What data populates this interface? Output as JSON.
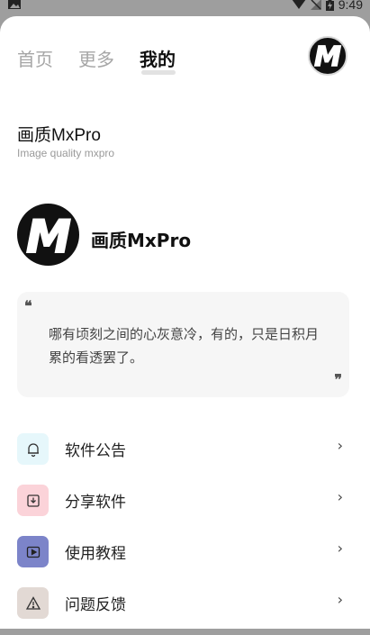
{
  "status_bar": {
    "time": "9:49"
  },
  "tabs": [
    {
      "label": "首页",
      "active": false
    },
    {
      "label": "更多",
      "active": false
    },
    {
      "label": "我的",
      "active": true
    }
  ],
  "app": {
    "title": "画质MxPro",
    "subtitle": "Image quality mxpro"
  },
  "profile": {
    "name": "画质MxPro",
    "logo_text": "M"
  },
  "quote": {
    "open_mark": "❝",
    "text": "哪有顷刻之间的心灰意冷，有的，只是日积月累的看透罢了。",
    "close_mark": "❞"
  },
  "menu": [
    {
      "label": "软件公告",
      "icon": "bell-icon",
      "color": "#e6f7fb"
    },
    {
      "label": "分享软件",
      "icon": "download-box-icon",
      "color": "#fbd3d9"
    },
    {
      "label": "使用教程",
      "icon": "play-video-icon",
      "color": "#7c84c9"
    },
    {
      "label": "问题反馈",
      "icon": "warning-icon",
      "color": "#e2d9d4"
    }
  ],
  "chevron": "›"
}
